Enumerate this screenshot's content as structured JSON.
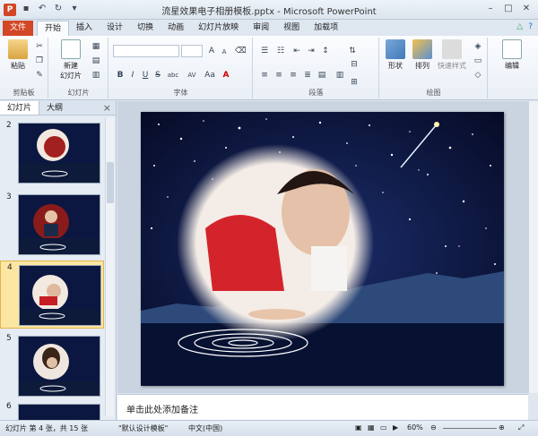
{
  "window": {
    "title": "流星效果电子相册模板.pptx - Microsoft PowerPoint",
    "app_icon_letter": "P"
  },
  "tabs": [
    {
      "label": "文件",
      "kind": "file"
    },
    {
      "label": "开始",
      "kind": "active"
    },
    {
      "label": "插入",
      "kind": ""
    },
    {
      "label": "设计",
      "kind": ""
    },
    {
      "label": "切换",
      "kind": ""
    },
    {
      "label": "动画",
      "kind": ""
    },
    {
      "label": "幻灯片放映",
      "kind": ""
    },
    {
      "label": "审阅",
      "kind": ""
    },
    {
      "label": "视图",
      "kind": ""
    },
    {
      "label": "加载项",
      "kind": ""
    }
  ],
  "ribbon": {
    "clipboard": {
      "paste_label": "粘贴",
      "group_label": "剪贴板"
    },
    "slides": {
      "new_slide_label": "新建\n幻灯片",
      "group_label": "幻灯片"
    },
    "font": {
      "group_label": "字体",
      "bold": "B",
      "italic": "I",
      "underline": "U",
      "strike": "S",
      "shadow": "abc",
      "spacing": "AV",
      "case": "Aa",
      "grow": "A",
      "shrink": "A"
    },
    "paragraph": {
      "group_label": "段落"
    },
    "drawing": {
      "group_label": "绘图",
      "shape_label": "形状",
      "arrange_label": "排列",
      "quick_style_label": "快速样式"
    },
    "editing": {
      "label": "编辑"
    }
  },
  "left_pane": {
    "tab_slides": "幻灯片",
    "tab_outline": "大纲",
    "close": "×",
    "slides": [
      {
        "number": "2"
      },
      {
        "number": "3"
      },
      {
        "number": "4",
        "selected": true
      },
      {
        "number": "5"
      },
      {
        "number": "6"
      }
    ]
  },
  "notes": {
    "placeholder": "单击此处添加备注"
  },
  "status_bar": {
    "slide_info": "幻灯片 第 4 张，共 15 张",
    "theme": "\"默认设计模板\"",
    "language": "中文(中国)",
    "zoom": "60%"
  },
  "colors": {
    "file_tab": "#d24726",
    "selected_thumb": "#fbe6a2",
    "slide_sky": "#0b1740"
  }
}
